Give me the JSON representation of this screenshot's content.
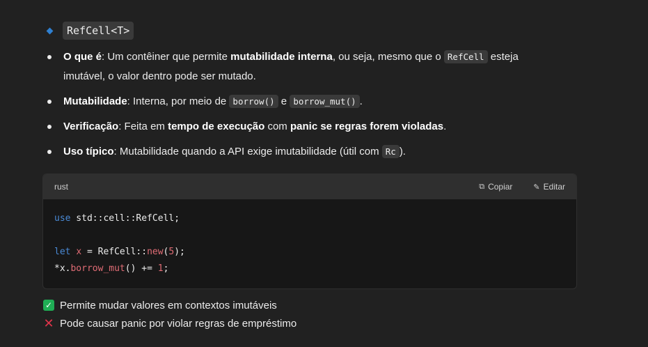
{
  "heading": {
    "code": "RefCell<T>"
  },
  "bullets": [
    {
      "label": "O que é",
      "t1": ": Um contêiner que permite ",
      "b1": "mutabilidade interna",
      "t2": ", ou seja, mesmo que o ",
      "code1": "RefCell",
      "t3": " esteja",
      "t4": "imutável, o valor dentro pode ser mutado."
    },
    {
      "label": "Mutabilidade",
      "t1": ": Interna, por meio de ",
      "code1": "borrow()",
      "t2": " e ",
      "code2": "borrow_mut()",
      "t3": "."
    },
    {
      "label": "Verificação",
      "t1": ": Feita em ",
      "b1": "tempo de execução",
      "t2": " com ",
      "b2": "panic se regras forem violadas",
      "t3": "."
    },
    {
      "label": "Uso típico",
      "t1": ": Mutabilidade quando a API exige imutabilidade (útil com ",
      "code1": "Rc",
      "t2": ")."
    }
  ],
  "codeblock": {
    "language": "rust",
    "copy_label": "Copiar",
    "edit_label": "Editar",
    "lines": {
      "l1_kw": "use",
      "l1_rest": " std::cell::RefCell;",
      "l3_kw": "let",
      "l3_var": "x",
      "l3_mid": " = RefCell::",
      "l3_fn": "new",
      "l3_p1": "(",
      "l3_num": "5",
      "l3_p2": ");",
      "l4_a": "*x.",
      "l4_fn": "borrow_mut",
      "l4_b": "() += ",
      "l4_num": "1",
      "l4_c": ";"
    }
  },
  "checklist": [
    {
      "icon": "check-icon",
      "text": "Permite mudar valores em contextos imutáveis"
    },
    {
      "icon": "x-icon",
      "text": "Pode causar panic por violar regras de empréstimo"
    }
  ]
}
